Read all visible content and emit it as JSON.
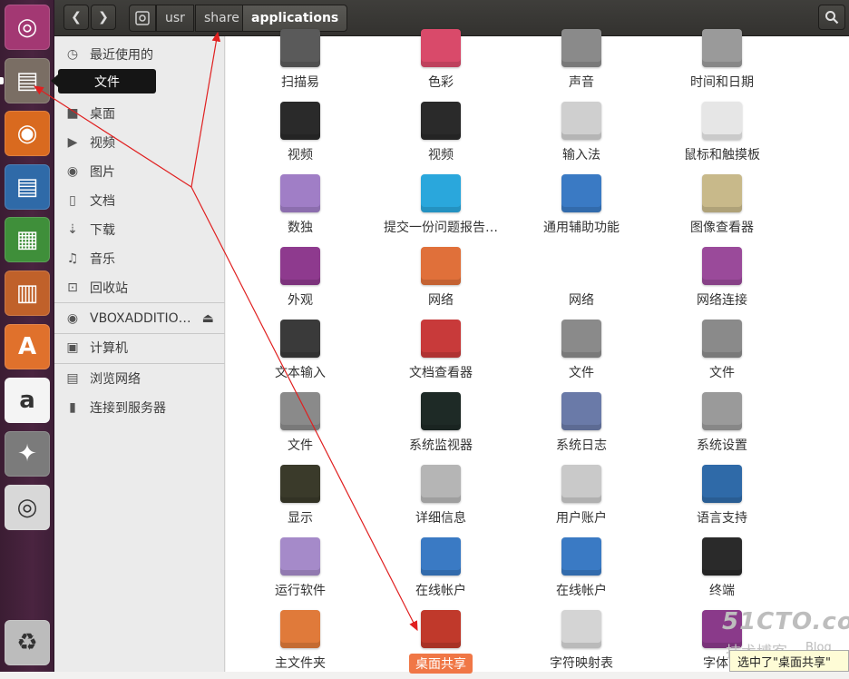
{
  "header": {
    "back_glyph": "❮",
    "forward_glyph": "❯",
    "breadcrumbs": [
      "usr",
      "share",
      "applications"
    ]
  },
  "tooltip": "文件",
  "sidebar": {
    "items": [
      {
        "label": "最近使用的",
        "icon": "clock-icon"
      },
      {
        "label": "桌面",
        "icon": "folder-icon"
      },
      {
        "label": "视频",
        "icon": "video-icon"
      },
      {
        "label": "图片",
        "icon": "camera-icon"
      },
      {
        "label": "文档",
        "icon": "document-icon"
      },
      {
        "label": "下载",
        "icon": "download-icon"
      },
      {
        "label": "音乐",
        "icon": "music-icon"
      },
      {
        "label": "回收站",
        "icon": "trash-icon"
      },
      {
        "label": "VBOXADDITIO…",
        "icon": "disc-icon"
      },
      {
        "label": "计算机",
        "icon": "computer-icon"
      },
      {
        "label": "浏览网络",
        "icon": "network-icon"
      },
      {
        "label": "连接到服务器",
        "icon": "server-icon"
      }
    ]
  },
  "launcher": {
    "items": [
      {
        "name": "dash-icon",
        "glyph": "◎",
        "color": "#a33873"
      },
      {
        "name": "files-icon",
        "glyph": "▤",
        "color": "#7a6e64"
      },
      {
        "name": "firefox-icon",
        "glyph": "◉",
        "color": "#d96a1f"
      },
      {
        "name": "writer-icon",
        "glyph": "▤",
        "color": "#2f6aa8"
      },
      {
        "name": "calc-icon",
        "glyph": "▦",
        "color": "#3f8f3a"
      },
      {
        "name": "impress-icon",
        "glyph": "▥",
        "color": "#c0612a"
      },
      {
        "name": "software-center-icon",
        "glyph": "A",
        "color": "#e0712c"
      },
      {
        "name": "amazon-icon",
        "glyph": "a",
        "color": "#f4f4f4"
      },
      {
        "name": "system-settings-icon",
        "glyph": "✦",
        "color": "#7b7b7b"
      },
      {
        "name": "dvd-icon",
        "glyph": "◎",
        "color": "#d8d8d8"
      },
      {
        "name": "trash-icon",
        "glyph": "♻",
        "color": "#bcbcbc"
      }
    ]
  },
  "apps": {
    "rows": [
      [
        {
          "label": "扫描易",
          "icon": "scanner-icon",
          "color": "#5a5a5a"
        },
        {
          "label": "色彩",
          "icon": "color-icon",
          "color": "#d94a6a"
        },
        {
          "label": "声音",
          "icon": "sound-icon",
          "color": "#8a8a8a"
        },
        {
          "label": "时间和日期",
          "icon": "clock-icon",
          "color": "#9a9a9a"
        }
      ],
      [
        {
          "label": "视频",
          "icon": "video-clapper-icon",
          "color": "#2a2a2a"
        },
        {
          "label": "视频",
          "icon": "video-clapper-icon",
          "color": "#2a2a2a"
        },
        {
          "label": "输入法",
          "icon": "keyboard-icon",
          "color": "#cfcfcf"
        },
        {
          "label": "鼠标和触摸板",
          "icon": "mouse-icon",
          "color": "#e6e6e6"
        }
      ],
      [
        {
          "label": "数独",
          "icon": "sudoku-icon",
          "color": "#a07ec6"
        },
        {
          "label": "提交一份问题报告…",
          "icon": "bug-report-icon",
          "color": "#2aa7dc"
        },
        {
          "label": "通用辅助功能",
          "icon": "accessibility-icon",
          "color": "#3a7ac4"
        },
        {
          "label": "图像查看器",
          "icon": "image-viewer-icon",
          "color": "#c8b98a"
        }
      ],
      [
        {
          "label": "外观",
          "icon": "appearance-icon",
          "color": "#8e3a8e"
        },
        {
          "label": "网络",
          "icon": "network-folder-icon",
          "color": "#e0703a"
        },
        {
          "label": "网络",
          "icon": "wifi-icon",
          "color": "#bdbdbd"
        },
        {
          "label": "网络连接",
          "icon": "network-connections-icon",
          "color": "#9a4a9a"
        }
      ],
      [
        {
          "label": "文本输入",
          "icon": "text-entry-icon",
          "color": "#3a3a3a"
        },
        {
          "label": "文档查看器",
          "icon": "document-viewer-icon",
          "color": "#c83a3a"
        },
        {
          "label": "文件",
          "icon": "file-cabinet-icon",
          "color": "#8a8a8a"
        },
        {
          "label": "文件",
          "icon": "file-cabinet-icon",
          "color": "#8a8a8a"
        }
      ],
      [
        {
          "label": "文件",
          "icon": "file-cabinet-icon",
          "color": "#8a8a8a"
        },
        {
          "label": "系统监视器",
          "icon": "system-monitor-icon",
          "color": "#1e2a26"
        },
        {
          "label": "系统日志",
          "icon": "system-log-icon",
          "color": "#6a7aa8"
        },
        {
          "label": "系统设置",
          "icon": "system-settings-icon",
          "color": "#9a9a9a"
        }
      ],
      [
        {
          "label": "显示",
          "icon": "display-icon",
          "color": "#3a3a2a"
        },
        {
          "label": "详细信息",
          "icon": "details-gear-icon",
          "color": "#b5b5b5"
        },
        {
          "label": "用户账户",
          "icon": "user-accounts-icon",
          "color": "#c9c9c9"
        },
        {
          "label": "语言支持",
          "icon": "language-support-icon",
          "color": "#2f6aa8"
        }
      ],
      [
        {
          "label": "运行软件",
          "icon": "run-software-icon",
          "color": "#a58ac9"
        },
        {
          "label": "在线帐户",
          "icon": "online-accounts-icon",
          "color": "#3a7ac4"
        },
        {
          "label": "在线帐户",
          "icon": "online-accounts-icon",
          "color": "#3a7ac4"
        },
        {
          "label": "终端",
          "icon": "terminal-icon",
          "color": "#2a2a2a"
        }
      ],
      [
        {
          "label": "主文件夹",
          "icon": "home-folder-icon",
          "color": "#e07a3a"
        },
        {
          "label": "桌面共享",
          "icon": "desktop-sharing-icon",
          "color": "#c0392b",
          "selected": true
        },
        {
          "label": "字符映射表",
          "icon": "character-map-icon",
          "color": "#d4d4d4"
        },
        {
          "label": "字体查",
          "icon": "font-viewer-icon",
          "color": "#8a3a8a"
        }
      ]
    ]
  },
  "watermark": {
    "main": "51CTO.com",
    "sub": "技术博客",
    "blog": "Blog"
  },
  "status": "选中了\"桌面共享\""
}
